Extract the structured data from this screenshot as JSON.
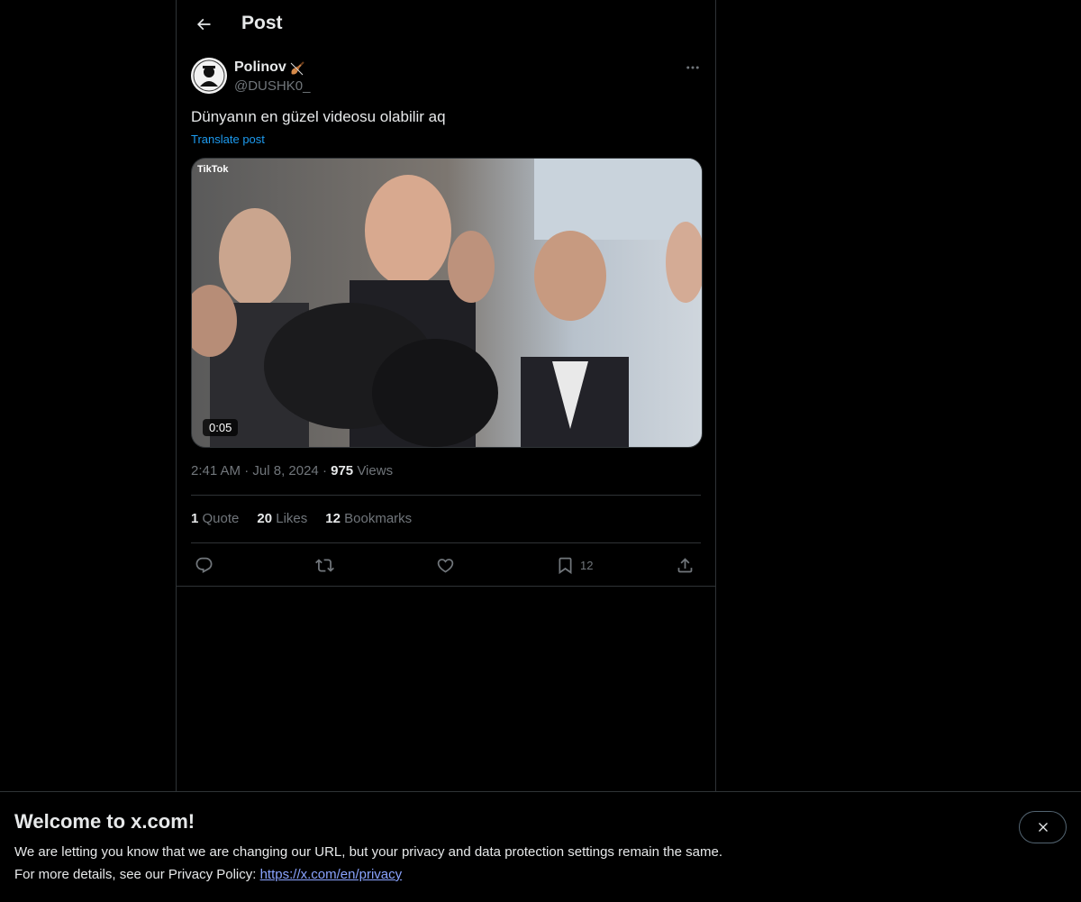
{
  "header": {
    "title": "Post",
    "back_icon": "arrow-left-icon"
  },
  "post": {
    "author_name": "Polinov",
    "author_emoji_icon": "violin-icon",
    "author_handle": "@DUSHK0_",
    "text": "Dünyanın en güzel videosu olabilir aq",
    "translate_label": "Translate post",
    "media": {
      "duration": "0:05",
      "watermark": "TikTok"
    },
    "time": "2:41 AM",
    "date": "Jul 8, 2024",
    "views_count": "975",
    "views_label": "Views",
    "stats": {
      "quotes_count": "1",
      "quotes_label": "Quote",
      "likes_count": "20",
      "likes_label": "Likes",
      "bookmarks_count": "12",
      "bookmarks_label": "Bookmarks"
    },
    "actions": {
      "bookmark_count": "12"
    }
  },
  "banner": {
    "title": "Welcome to x.com!",
    "line1": "We are letting you know that we are changing our URL, but your privacy and data protection settings remain the same.",
    "line2_prefix": "For more details, see our Privacy Policy: ",
    "link": "https://x.com/en/privacy"
  },
  "colors": {
    "background": "#000000",
    "text": "#e7e9ea",
    "muted": "#71767b",
    "accent": "#1d9bf0",
    "border": "#2f3336"
  }
}
